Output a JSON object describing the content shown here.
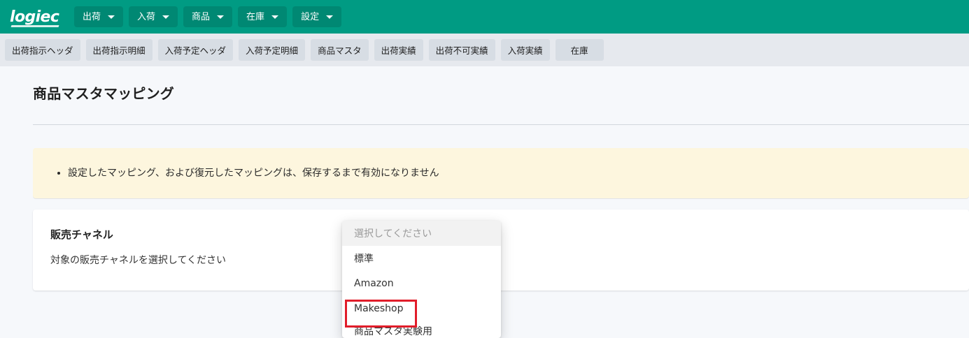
{
  "brand": {
    "logo_text": "logiec"
  },
  "topnav": [
    {
      "label": "出荷"
    },
    {
      "label": "入荷"
    },
    {
      "label": "商品"
    },
    {
      "label": "在庫"
    },
    {
      "label": "設定"
    }
  ],
  "subnav": [
    {
      "label": "出荷指示ヘッダ"
    },
    {
      "label": "出荷指示明細"
    },
    {
      "label": "入荷予定ヘッダ"
    },
    {
      "label": "入荷予定明細"
    },
    {
      "label": "商品マスタ"
    },
    {
      "label": "出荷実績"
    },
    {
      "label": "出荷不可実績"
    },
    {
      "label": "入荷実績"
    },
    {
      "label": "在庫"
    }
  ],
  "page": {
    "title": "商品マスタマッピング",
    "notice_items": [
      "設定したマッピング、および復元したマッピングは、保存するまで有効になりません"
    ],
    "channel_card": {
      "title": "販売チャネル",
      "description": "対象の販売チャネルを選択してください"
    }
  },
  "dropdown": {
    "placeholder": "選択してください",
    "options": [
      {
        "label": "標準"
      },
      {
        "label": "Amazon"
      },
      {
        "label": "Makeshop"
      },
      {
        "label": "商品マスタ実験用"
      }
    ]
  },
  "colors": {
    "topbar": "#009b83",
    "subbar": "#e6e9ee",
    "notice_bg": "#fdf6de",
    "highlight": "#e11d2a"
  }
}
